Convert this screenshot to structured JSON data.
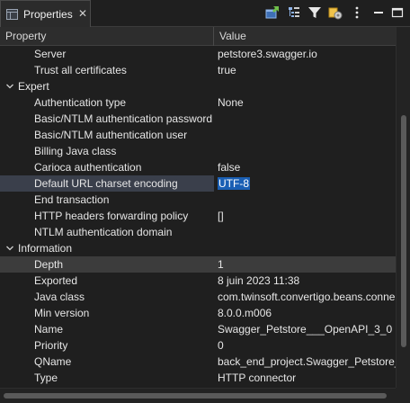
{
  "tab": {
    "label": "Properties",
    "close": "✕"
  },
  "toolbar": {
    "buttons": [
      {
        "name": "pin-view-icon"
      },
      {
        "name": "show-categories-icon"
      },
      {
        "name": "filter-icon"
      },
      {
        "name": "show-advanced-icon"
      },
      {
        "name": "view-menu-icon"
      },
      {
        "name": "minimize-icon"
      },
      {
        "name": "maximize-icon"
      }
    ]
  },
  "columns": {
    "property": "Property",
    "value": "Value"
  },
  "rows": [
    {
      "type": "prop",
      "name": "Server",
      "value": "petstore3.swagger.io"
    },
    {
      "type": "prop",
      "name": "Trust all certificates",
      "value": "true"
    },
    {
      "type": "cat",
      "name": "Expert",
      "expanded": true
    },
    {
      "type": "prop",
      "name": "Authentication type",
      "value": "None"
    },
    {
      "type": "prop",
      "name": "Basic/NTLM authentication password",
      "value": ""
    },
    {
      "type": "prop",
      "name": "Basic/NTLM authentication user",
      "value": ""
    },
    {
      "type": "prop",
      "name": "Billing Java class",
      "value": ""
    },
    {
      "type": "prop",
      "name": "Carioca authentication",
      "value": "false"
    },
    {
      "type": "prop",
      "name": "Default URL charset encoding",
      "value": "UTF-8",
      "selected": true,
      "editing": true
    },
    {
      "type": "prop",
      "name": "End transaction",
      "value": ""
    },
    {
      "type": "prop",
      "name": "HTTP headers forwarding policy",
      "value": "[]"
    },
    {
      "type": "prop",
      "name": "NTLM authentication domain",
      "value": ""
    },
    {
      "type": "cat",
      "name": "Information",
      "expanded": true
    },
    {
      "type": "prop",
      "name": "Depth",
      "value": "1",
      "highlight": true
    },
    {
      "type": "prop",
      "name": "Exported",
      "value": "8 juin 2023 11:38"
    },
    {
      "type": "prop",
      "name": "Java class",
      "value": "com.twinsoft.convertigo.beans.conne"
    },
    {
      "type": "prop",
      "name": "Min version",
      "value": "8.0.0.m006"
    },
    {
      "type": "prop",
      "name": "Name",
      "value": "Swagger_Petstore___OpenAPI_3_0"
    },
    {
      "type": "prop",
      "name": "Priority",
      "value": "0"
    },
    {
      "type": "prop",
      "name": "QName",
      "value": "back_end_project.Swagger_Petstore__"
    },
    {
      "type": "prop",
      "name": "Type",
      "value": "HTTP connector"
    }
  ],
  "colors": {
    "background": "#1f1f1f",
    "selection": "#3a3f4b",
    "value_highlight": "#1a5fb4",
    "row_highlight": "#3c3c3c"
  }
}
